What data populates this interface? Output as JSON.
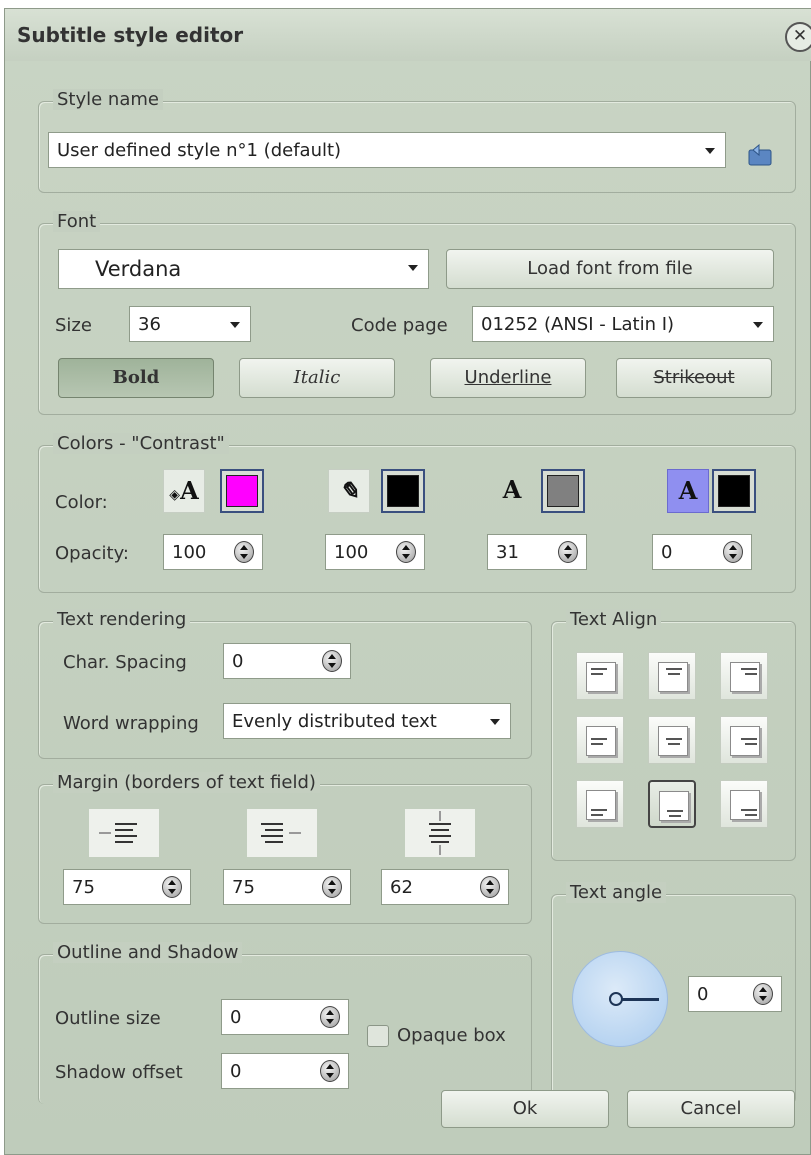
{
  "window": {
    "title": "Subtitle style editor"
  },
  "style_name": {
    "legend": "Style name",
    "value": "User defined style n°1 (default)"
  },
  "font": {
    "legend": "Font",
    "family": "Verdana",
    "load_button": "Load font from file",
    "size_label": "Size",
    "size_value": "36",
    "codepage_label": "Code page",
    "codepage_value": "01252 (ANSI - Latin I)",
    "bold": "Bold",
    "italic": "Italic",
    "underline": "Underline",
    "strikeout": "Strikeout"
  },
  "colors": {
    "legend": "Colors - \"Contrast\"",
    "color_label": "Color:",
    "opacity_label": "Opacity:",
    "items": [
      {
        "icon": "fill-a-icon",
        "glyph": "A",
        "color": "#ff00ff",
        "opacity": "100"
      },
      {
        "icon": "outline-pen-icon",
        "glyph": "✎",
        "color": "#000000",
        "opacity": "100"
      },
      {
        "icon": "shadow-a-icon",
        "glyph": "A",
        "color": "#808080",
        "opacity": "31"
      },
      {
        "icon": "background-a-icon",
        "glyph": "A",
        "color": "#000000",
        "opacity": "0"
      }
    ]
  },
  "text_rendering": {
    "legend": "Text rendering",
    "spacing_label": "Char. Spacing",
    "spacing_value": "0",
    "wrapping_label": "Word wrapping",
    "wrapping_value": "Evenly distributed text"
  },
  "text_align": {
    "legend": "Text Align",
    "selected": "bottom-center"
  },
  "margin": {
    "legend": "Margin  (borders of text field)",
    "left": "75",
    "right": "75",
    "vertical": "62"
  },
  "outline_shadow": {
    "legend": "Outline  and Shadow",
    "outline_label": "Outline size",
    "outline_value": "0",
    "shadow_label": "Shadow offset",
    "shadow_value": "0",
    "opaque_label": "Opaque box"
  },
  "text_angle": {
    "legend": "Text angle",
    "value": "0"
  },
  "buttons": {
    "ok": "Ok",
    "cancel": "Cancel"
  },
  "colors_theme": {
    "window_bg": "#c4cfc0",
    "selected_swatch_border": "#3a4f7f"
  }
}
